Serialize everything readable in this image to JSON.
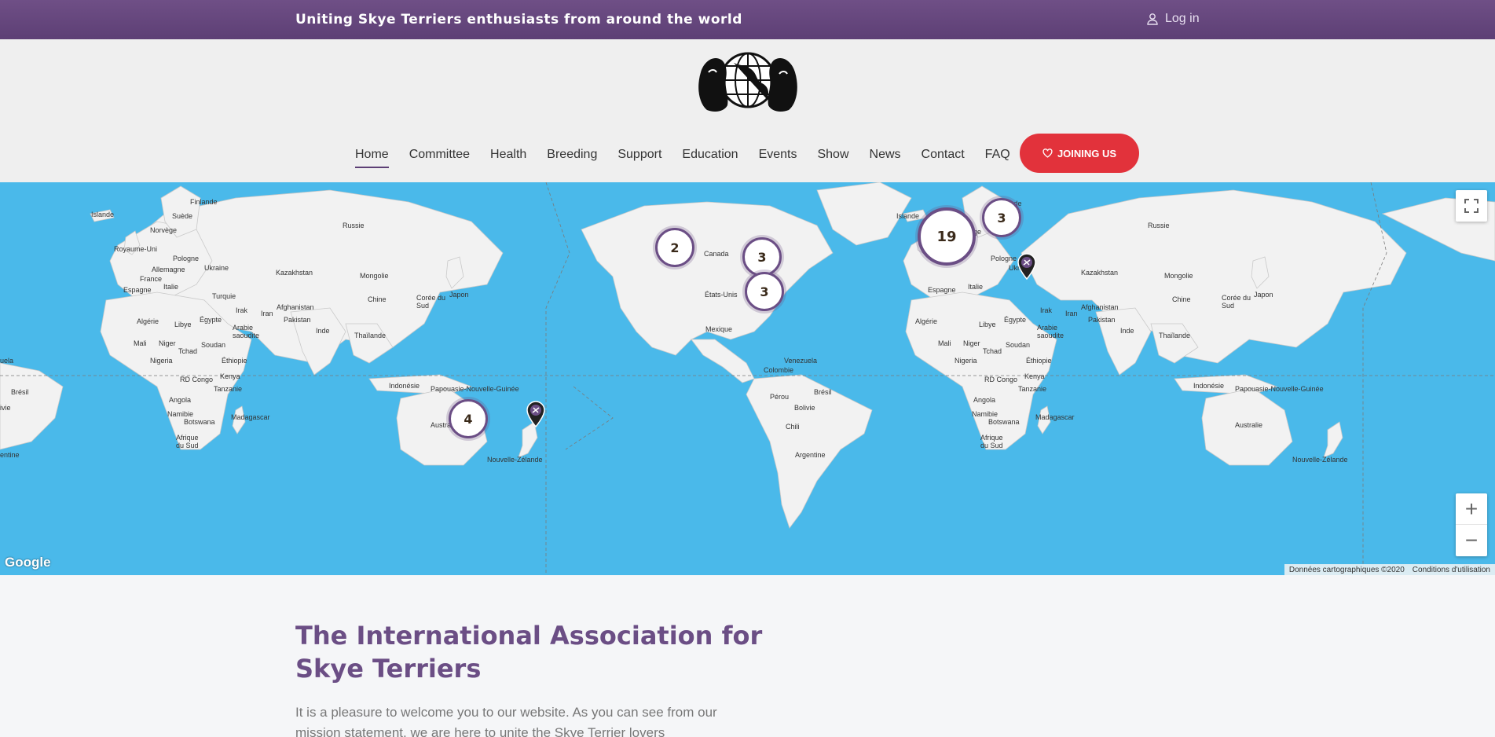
{
  "topbar": {
    "tagline": "Uniting Skye Terriers enthusiasts from around the world",
    "login_label": "Log in",
    "login_icon": "user-icon"
  },
  "header": {
    "logo_icon": "skye-terrier-globe-logo",
    "nav": [
      {
        "label": "Home",
        "active": true
      },
      {
        "label": "Committee"
      },
      {
        "label": "Health"
      },
      {
        "label": "Breeding"
      },
      {
        "label": "Support"
      },
      {
        "label": "Education"
      },
      {
        "label": "Events"
      },
      {
        "label": "Show"
      },
      {
        "label": "News"
      },
      {
        "label": "Contact"
      },
      {
        "label": "FAQ"
      }
    ],
    "join_label": "JOINING US",
    "join_icon": "heart-icon"
  },
  "map": {
    "clusters": [
      "3",
      "19",
      "2",
      "3",
      "3",
      "4"
    ],
    "labels": {
      "finlande": "Finlande",
      "islande": "Islande",
      "suede": "Suède",
      "norvege": "Norvège",
      "russie": "Russie",
      "royaume_uni": "Royaume-Uni",
      "pologne": "Pologne",
      "allemagne": "Allemagne",
      "ukraine": "Ukraine",
      "kazakhstan": "Kazakhstan",
      "france": "France",
      "italie": "Italie",
      "mongolie": "Mongolie",
      "espagne": "Espagne",
      "turquie": "Turquie",
      "chine": "Chine",
      "coree": "Corée du Sud",
      "japon": "Japon",
      "irak": "Irak",
      "iran": "Iran",
      "afghanistan": "Afghanistan",
      "algerie": "Algérie",
      "libye": "Libye",
      "egypte": "Égypte",
      "arabie": "Arabie saoudite",
      "pakistan": "Pakistan",
      "inde": "Inde",
      "thailande": "Thaïlande",
      "mali": "Mali",
      "niger": "Niger",
      "tchad": "Tchad",
      "soudan": "Soudan",
      "nigeria": "Nigeria",
      "ethiopie": "Éthiopie",
      "rdcongo": "RD Congo",
      "kenya": "Kenya",
      "tanzanie": "Tanzanie",
      "indonesie": "Indonésie",
      "papouasie": "Papouasie-Nouvelle-Guinée",
      "angola": "Angola",
      "namibie": "Namibie",
      "botswana": "Botswana",
      "madagascar": "Madagascar",
      "afriquesud": "Afrique du Sud",
      "australie": "Australie",
      "nz": "Nouvelle-Zélande",
      "bresil": "Brésil",
      "canada": "Canada",
      "etatsunis": "États-Unis",
      "mexique": "Mexique",
      "venezuela": "Venezuela",
      "colombie": "Colombie",
      "perou": "Pérou",
      "bolivie": "Bolivie",
      "chili": "Chili",
      "argentine": "Argentine",
      "uela": "uela",
      "ivie": "ivie",
      "entine": "entine"
    },
    "google": "Google",
    "attribution": "Données cartographiques ©2020",
    "terms": "Conditions d'utilisation",
    "zoom_in": "+",
    "zoom_out": "−",
    "fullscreen_icon": "fullscreen-icon",
    "pin_icon": "map-pin-icon"
  },
  "content": {
    "title": "The International Association for Skye Terriers",
    "text": "It is a pleasure to welcome you to our website. As you can see from our mission statement, we are here to unite the Skye Terrier lovers"
  }
}
